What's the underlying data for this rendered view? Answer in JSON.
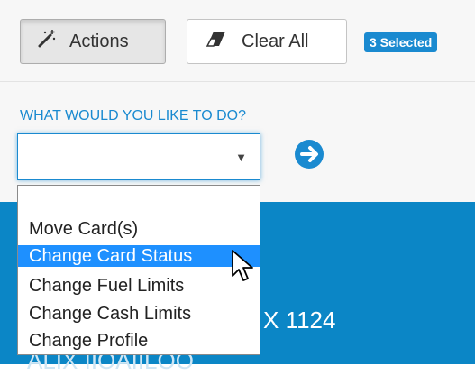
{
  "toolbar": {
    "actions_label": "Actions",
    "clear_label": "Clear All",
    "selected_badge": "3 Selected"
  },
  "question": {
    "label": "WHAT WOULD YOU LIKE TO DO?",
    "selected_value": "",
    "caret": "▼"
  },
  "dropdown": {
    "options": [
      {
        "label": ""
      },
      {
        "label": "Move Card(s)"
      },
      {
        "label": "Change Card Status"
      },
      {
        "label": "Change Fuel Limits"
      },
      {
        "label": "Change Cash Limits"
      },
      {
        "label": "Change Profile"
      }
    ],
    "highlighted_index": 2
  },
  "card": {
    "number_fragment": "X 1124",
    "sub_fragment": "ALIX  IIOAIILOO"
  },
  "colors": {
    "accent": "#1a8ad0",
    "panel": "#0b86c6",
    "highlight": "#1e90ff"
  }
}
